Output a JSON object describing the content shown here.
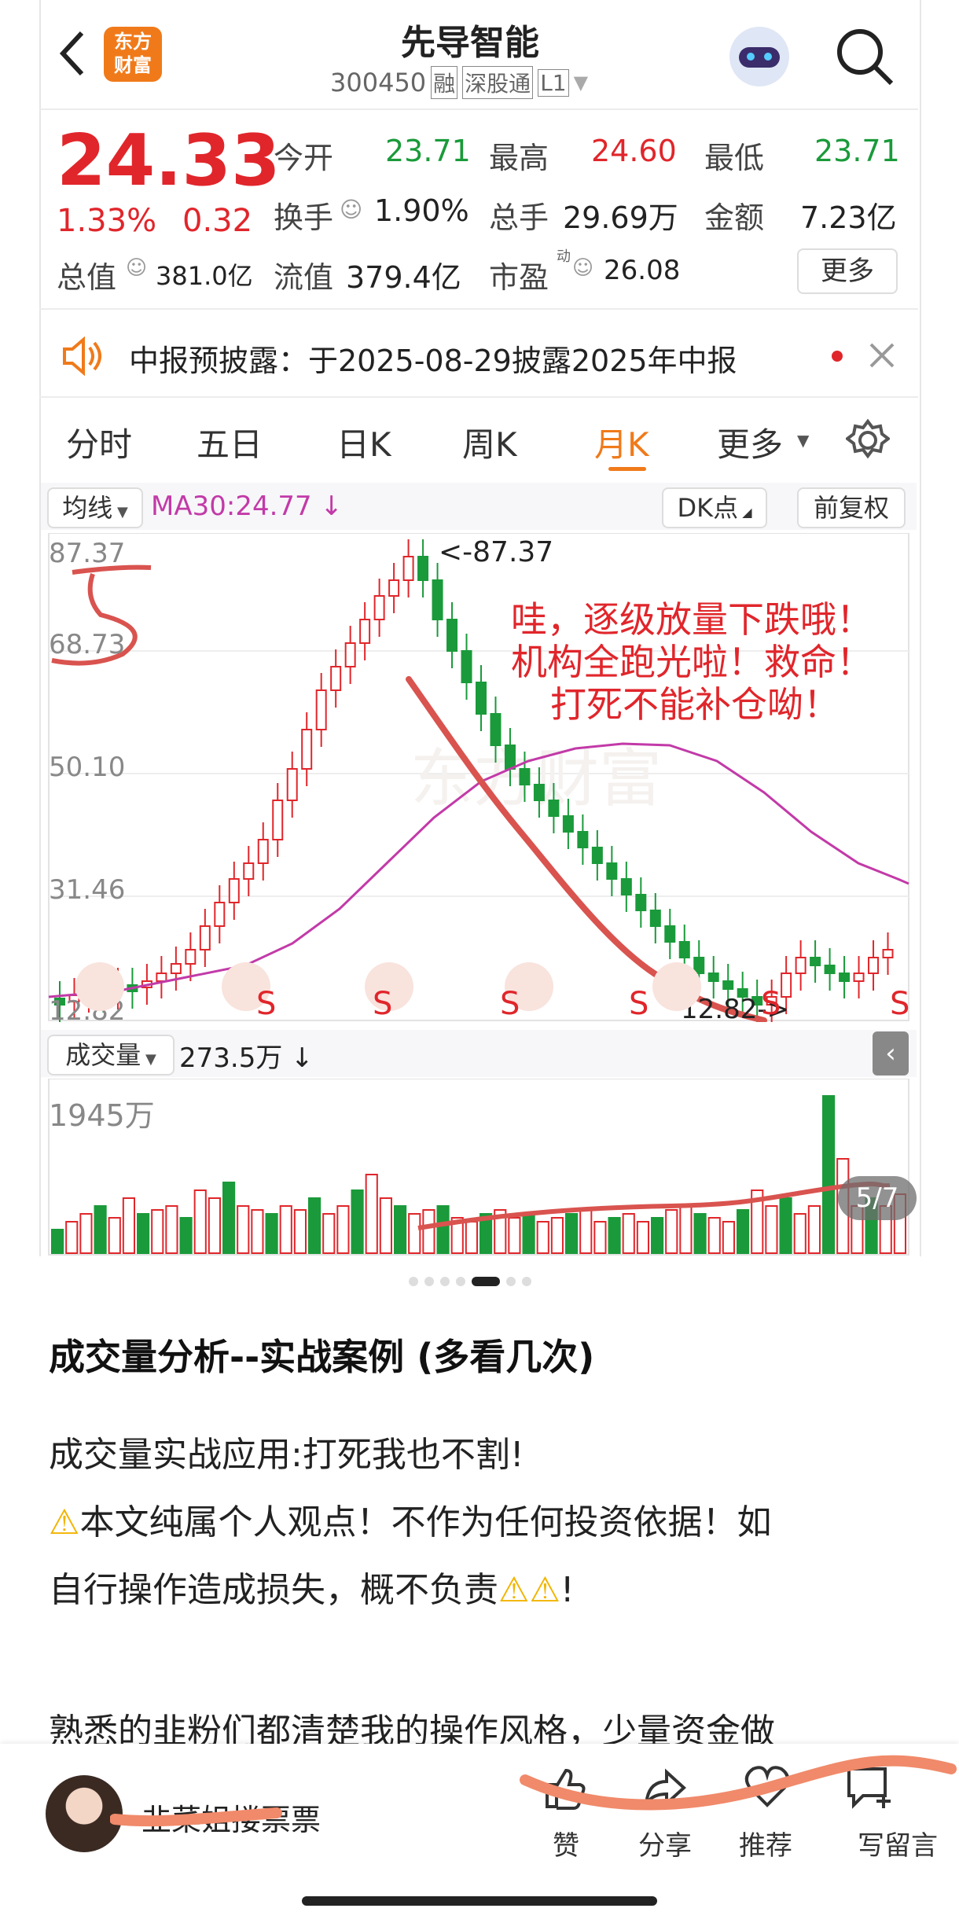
{
  "header": {
    "back_icon": "chevron-left-icon",
    "logo_text": "东方\n财富",
    "stock_name": "先导智能",
    "stock_code": "300450",
    "tags": [
      "融",
      "深股通",
      "L1"
    ]
  },
  "quote": {
    "price": "24.33",
    "change_pct": "1.33%",
    "change": "0.32",
    "stats": [
      {
        "label": "今开",
        "value": "23.71",
        "color": "green"
      },
      {
        "label": "最高",
        "value": "24.60",
        "color": "red"
      },
      {
        "label": "最低",
        "value": "23.71",
        "color": "green"
      },
      {
        "label": "换手",
        "value": "1.90%",
        "color": "dark"
      },
      {
        "label": "总手",
        "value": "29.69万",
        "color": "dark"
      },
      {
        "label": "金额",
        "value": "7.23亿",
        "color": "dark"
      }
    ],
    "total_value_label": "总值",
    "total_value": "381.0亿",
    "float_label": "流值",
    "float_value": "379.4亿",
    "pe_label": "市盈",
    "pe_sup": "动",
    "pe_value": "26.08",
    "more_label": "更多"
  },
  "notice": {
    "text": "中报预披露：于2025-08-29披露2025年中报"
  },
  "tabs": [
    "分时",
    "五日",
    "日K",
    "周K",
    "月K",
    "更多"
  ],
  "chart_controls": {
    "ma_dropdown": "均线",
    "ma_text": "MA30:24.77 ↓",
    "dk_label": "DK点",
    "fq_label": "前复权"
  },
  "chart_data": {
    "type": "candlestick",
    "ylim": [
      12.82,
      87.37
    ],
    "ticks": [
      "87.37",
      "68.73",
      "50.10",
      "31.46",
      "12.82"
    ],
    "high_label": "<-87.37",
    "low_label": "12.82->",
    "ma_label": "MA30",
    "ma_color": "#c23aa8",
    "up_color": "#e0262b",
    "down_color": "#1a9a3a",
    "annotation": [
      "哇，逐级放量下跌哦！",
      "机构全跑光啦！救命！",
      "打死不能补仓呦！"
    ],
    "markers": [
      "S",
      "S",
      "S",
      "S",
      "S",
      "S"
    ]
  },
  "volume": {
    "dropdown": "成交量",
    "value": "273.5万 ↓",
    "max_label": "1945万",
    "page": "5/7"
  },
  "carousel": {
    "count": 7,
    "active": 4
  },
  "article": {
    "title": "成交量分析--实战案例 (多看几次)",
    "p1": "成交量实战应用:打死我也不割!",
    "p2a": "本文纯属个人观点！不作为任何投资依据！如",
    "p2b": "自行操作造成损失，概不负责",
    "p2c": "!",
    "p3": "熟悉的韭粉们都清楚我的操作风格，少量资金做"
  },
  "bottom": {
    "author": "韭菜姐搂票票",
    "actions": [
      {
        "label": "赞",
        "icon": "thumb-up-icon"
      },
      {
        "label": "分享",
        "icon": "share-icon"
      },
      {
        "label": "推荐",
        "icon": "heart-icon"
      },
      {
        "label": "写留言",
        "icon": "comment-icon"
      }
    ]
  }
}
